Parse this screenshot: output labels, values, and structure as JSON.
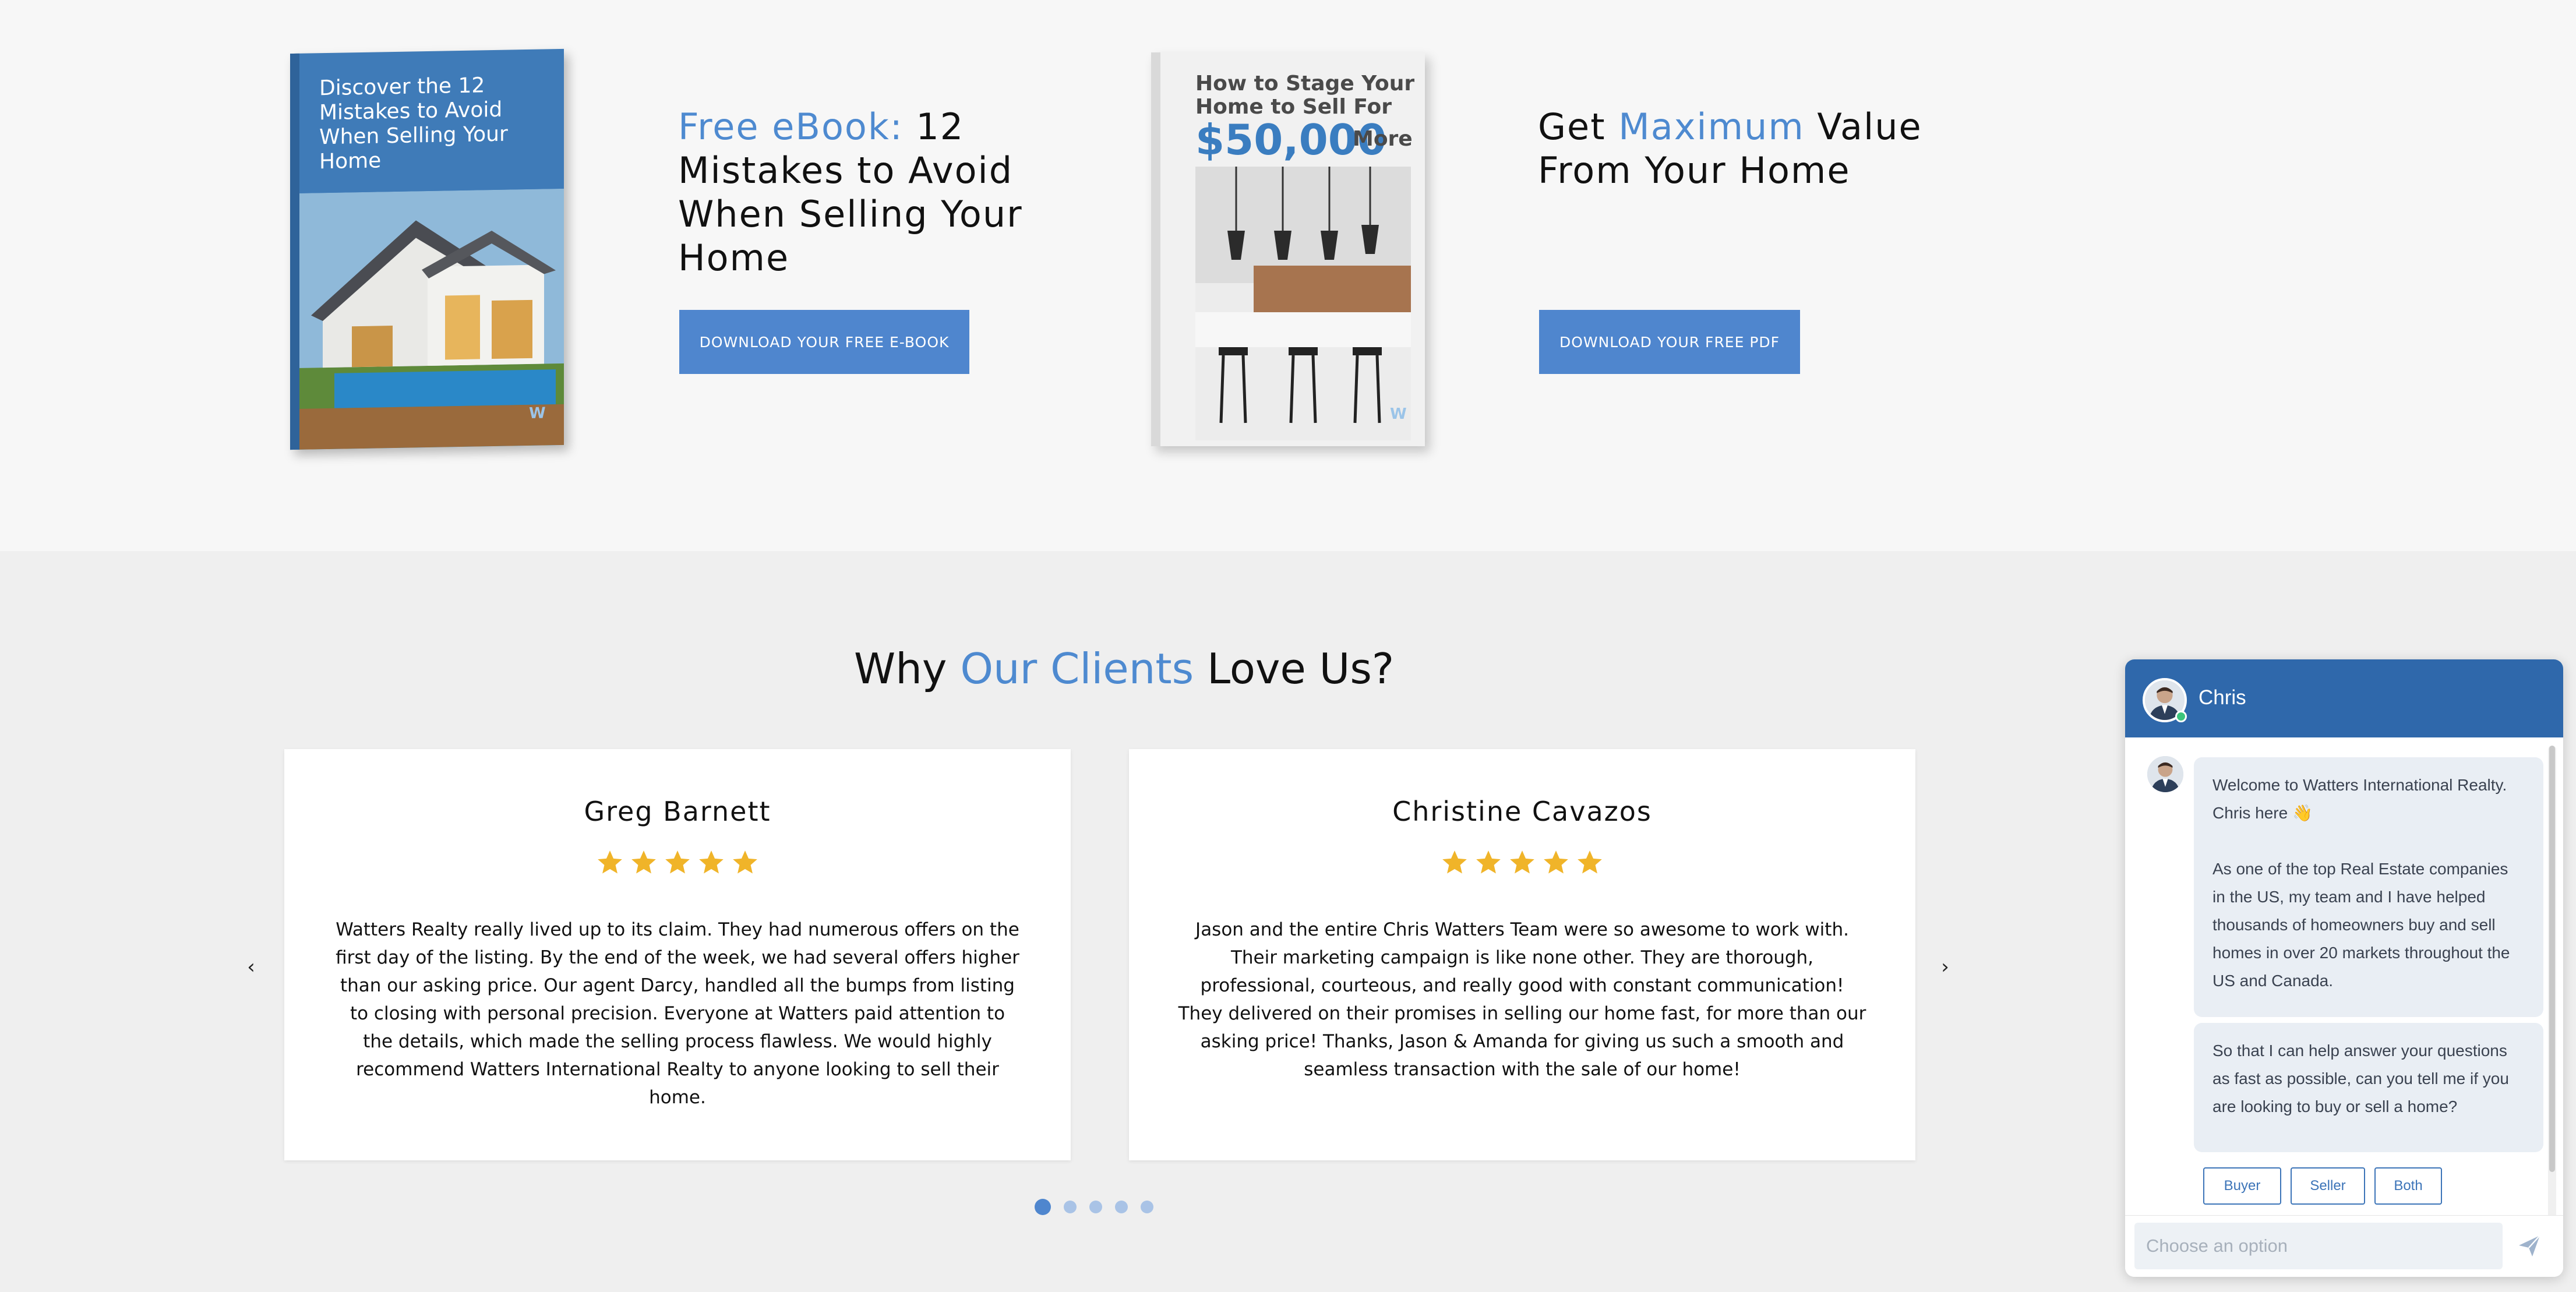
{
  "ebooks": {
    "book1_cover_text": "Discover the 12 Mistakes to Avoid When Selling Your Home",
    "book2_cover_line1": "How to Stage Your",
    "book2_cover_line2": "Home to Sell For",
    "book2_cover_amount": "$50,000",
    "book2_cover_more": "More",
    "promo1": {
      "title_accent": "Free eBook:",
      "title_rest": " 12 Mistakes to Avoid When Selling Your Home",
      "button_label": "DOWNLOAD YOUR FREE E-BOOK"
    },
    "promo2": {
      "title_pre": "Get ",
      "title_accent": "Maximum",
      "title_rest": " Value From Your Home",
      "button_label": "DOWNLOAD YOUR FREE PDF"
    }
  },
  "testimonials": {
    "heading_pre": "Why ",
    "heading_accent": "Our Clients",
    "heading_post": " Love Us?",
    "prev_label": "‹",
    "next_label": "›",
    "cards": [
      {
        "name": "Greg Barnett",
        "rating": 5,
        "quote": "Watters Realty really lived up to its claim. They had numerous offers on the first day of the listing. By the end of the week, we had several offers higher than our asking price. Our agent Darcy, handled all the bumps from listing to closing with personal precision. Everyone at Watters paid attention to the details, which made the selling process flawless. We would highly recommend Watters International Realty to anyone looking to sell their home."
      },
      {
        "name": "Christine Cavazos",
        "rating": 5,
        "quote": "Jason and the entire Chris Watters Team were so awesome to work with. Their marketing campaign is like none other. They are thorough, professional, courteous, and really good with constant communication! They delivered on their promises in selling our home fast, for more than our asking price! Thanks, Jason & Amanda for giving us such a smooth and seamless transaction with the sale of our home!"
      }
    ],
    "pagination": {
      "total": 5,
      "active_index": 0
    }
  },
  "chat": {
    "agent_name": "Chris",
    "messages": [
      {
        "paragraph1": "Welcome to Watters International Realty. Chris here 👋",
        "paragraph2": "As one of the top Real Estate companies in the US, my team and I have helped thousands of homeowners buy and sell homes in over 20 markets throughout the US and Canada."
      },
      {
        "paragraph1": "So that I can help answer your questions as fast as possible, can you tell me if you are looking to buy or sell a home?"
      }
    ],
    "options": [
      "Buyer",
      "Seller",
      "Both"
    ],
    "input_placeholder": "Choose an option"
  },
  "colors": {
    "accent_blue": "#4e8ad0",
    "button_blue": "#4f86ce",
    "chat_header": "#2f68ab",
    "star_gold": "#f0b429"
  }
}
